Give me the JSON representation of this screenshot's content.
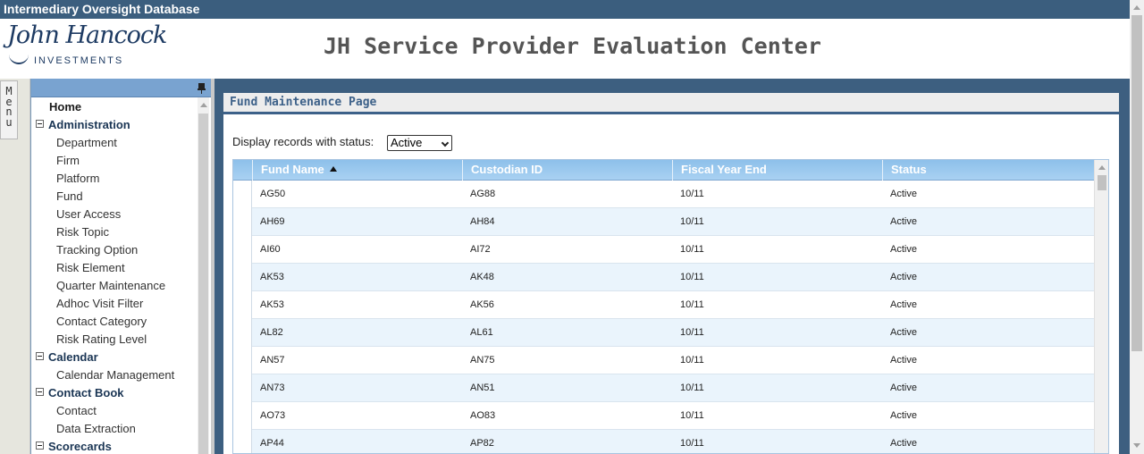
{
  "window": {
    "title": "Intermediary Oversight Database"
  },
  "header": {
    "logo_script": "John Hancock",
    "logo_sub": "INVESTMENTS",
    "app_title": "JH Service Provider Evaluation Center"
  },
  "menu_tab": {
    "letters": [
      "M",
      "e",
      "n",
      "u"
    ]
  },
  "sidebar": {
    "home": "Home",
    "groups": [
      {
        "label": "Administration",
        "items": [
          "Department",
          "Firm",
          "Platform",
          "Fund",
          "User Access",
          "Risk Topic",
          "Tracking Option",
          "Risk Element",
          "Quarter Maintenance",
          "Adhoc Visit Filter",
          "Contact Category",
          "Risk Rating Level"
        ]
      },
      {
        "label": "Calendar",
        "items": [
          "Calendar Management"
        ]
      },
      {
        "label": "Contact Book",
        "items": [
          "Contact",
          "Data Extraction"
        ]
      },
      {
        "label": "Scorecards",
        "items": []
      }
    ]
  },
  "page": {
    "title": "Fund Maintenance Page",
    "filter_label": "Display records with status:",
    "filter_value": "Active"
  },
  "grid": {
    "columns": [
      "Fund Name",
      "Custodian ID",
      "Fiscal Year End",
      "Status"
    ],
    "sort_column": "Fund Name",
    "sort_direction": "ascending",
    "rows": [
      [
        "AG50",
        "AG88",
        "10/11",
        "Active"
      ],
      [
        "AH69",
        "AH84",
        "10/11",
        "Active"
      ],
      [
        "AI60",
        "AI72",
        "10/11",
        "Active"
      ],
      [
        "AK53",
        "AK48",
        "10/11",
        "Active"
      ],
      [
        "AK53",
        "AK56",
        "10/11",
        "Active"
      ],
      [
        "AL82",
        "AL61",
        "10/11",
        "Active"
      ],
      [
        "AN57",
        "AN75",
        "10/11",
        "Active"
      ],
      [
        "AN73",
        "AN51",
        "10/11",
        "Active"
      ],
      [
        "AO73",
        "AO83",
        "10/11",
        "Active"
      ],
      [
        "AP44",
        "AP82",
        "10/11",
        "Active"
      ]
    ]
  },
  "colors": {
    "title_bar": "#3b5e7e",
    "sidebar_header": "#79a3d0",
    "grid_header": "#a9d1f2",
    "alt_row": "#eaf4fc",
    "page_title_text": "#3d6189"
  }
}
